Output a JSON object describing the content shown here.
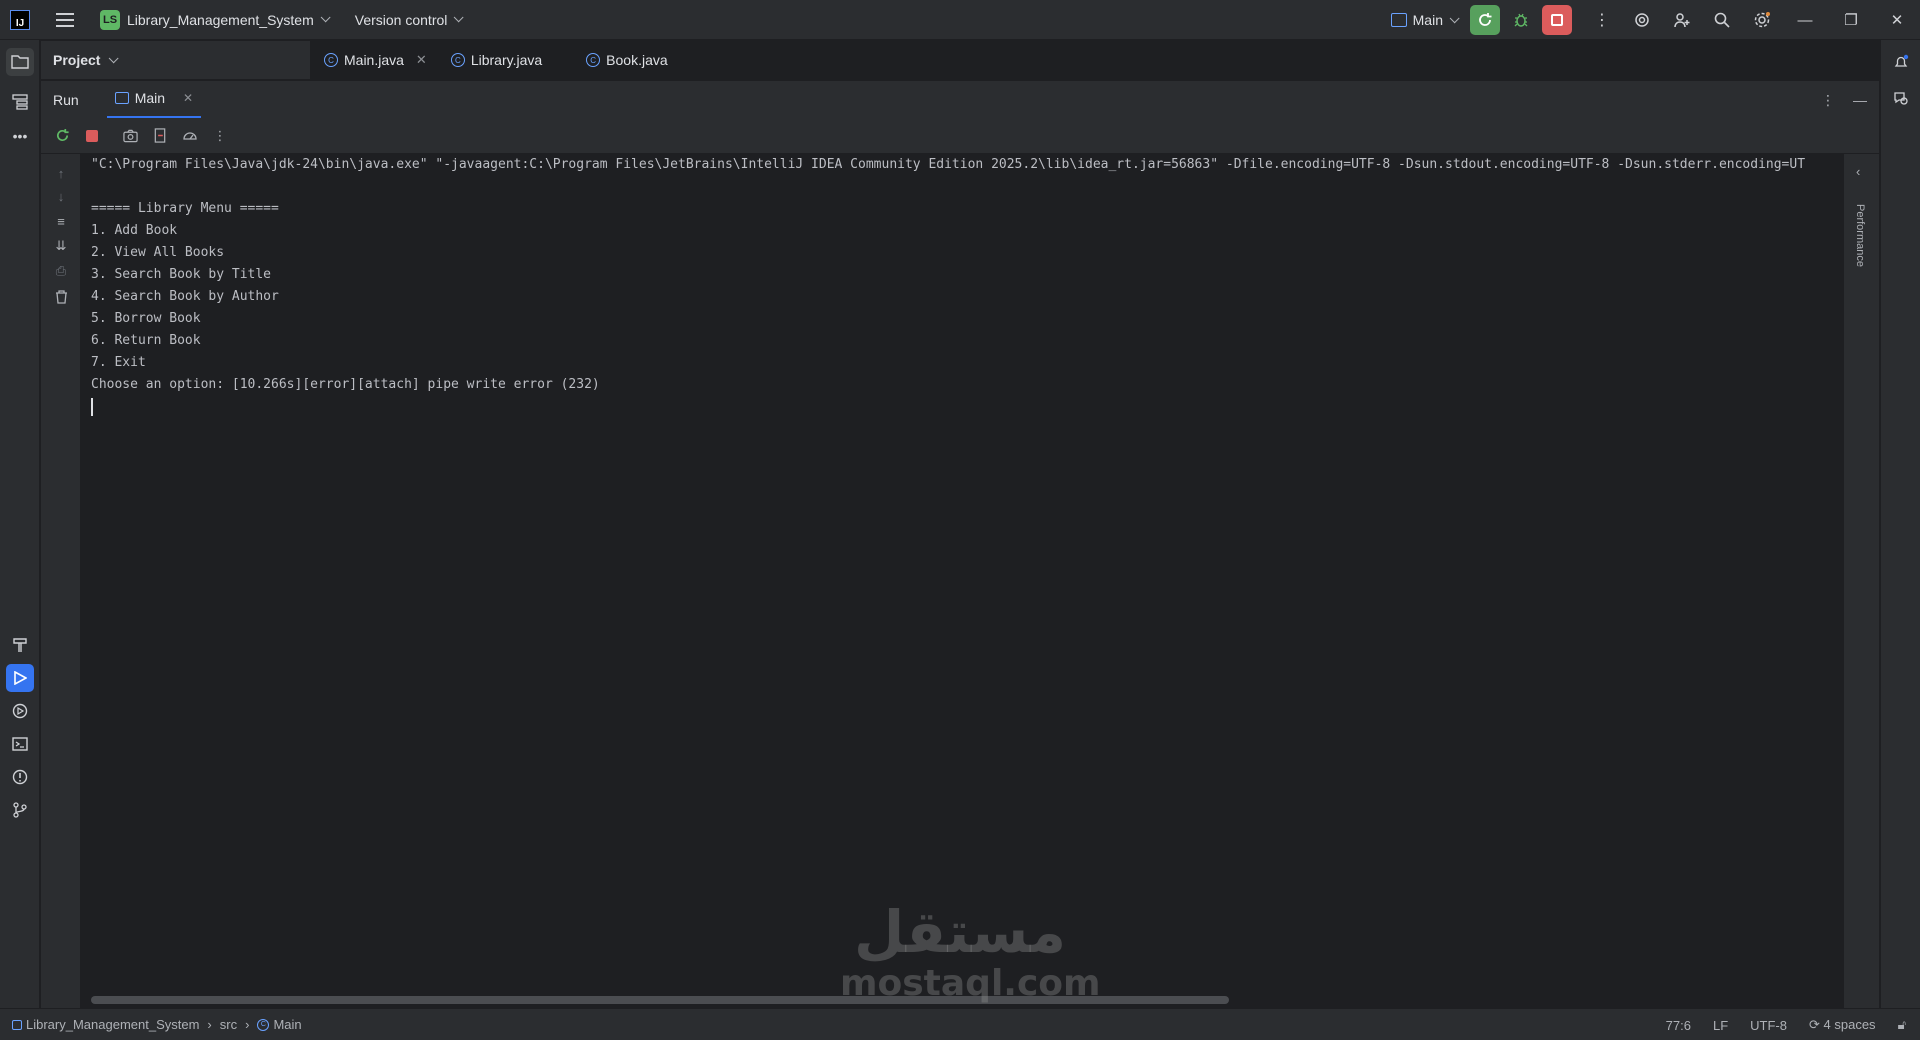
{
  "titlebar": {
    "app_logo": "IJ",
    "project_badge": "LS",
    "project_name": "Library_Management_System",
    "version_control": "Version control",
    "run_config": "Main"
  },
  "project_panel": {
    "title": "Project"
  },
  "editor_tabs": [
    {
      "label": "Main.java",
      "closable": true
    },
    {
      "label": "Library.java",
      "closable": false
    },
    {
      "label": "Book.java",
      "closable": false
    }
  ],
  "run_panel": {
    "title": "Run",
    "tab_label": "Main"
  },
  "console": {
    "lines": [
      "\"C:\\Program Files\\Java\\jdk-24\\bin\\java.exe\" \"-javaagent:C:\\Program Files\\JetBrains\\IntelliJ IDEA Community Edition 2025.2\\lib\\idea_rt.jar=56863\" -Dfile.encoding=UTF-8 -Dsun.stdout.encoding=UTF-8 -Dsun.stderr.encoding=UT",
      "",
      "===== Library Menu =====",
      "1. Add Book",
      "2. View All Books",
      "3. Search Book by Title",
      "4. Search Book by Author",
      "5. Borrow Book",
      "6. Return Book",
      "7. Exit",
      "Choose an option: [10.266s][error][attach] pipe write error (232)"
    ]
  },
  "performance_label": "Performance",
  "watermark": {
    "arabic": "مستقل",
    "latin": "mostaql.com"
  },
  "statusbar": {
    "breadcrumb": [
      "Library_Management_System",
      "src",
      "Main"
    ],
    "position": "77:6",
    "line_separator": "LF",
    "encoding": "UTF-8",
    "indent": "4 spaces"
  },
  "colors": {
    "accent": "#3574f0",
    "run_green": "#57a05d",
    "stop_red": "#db5c5c",
    "background": "#1e1f22",
    "panel": "#2b2d30"
  }
}
